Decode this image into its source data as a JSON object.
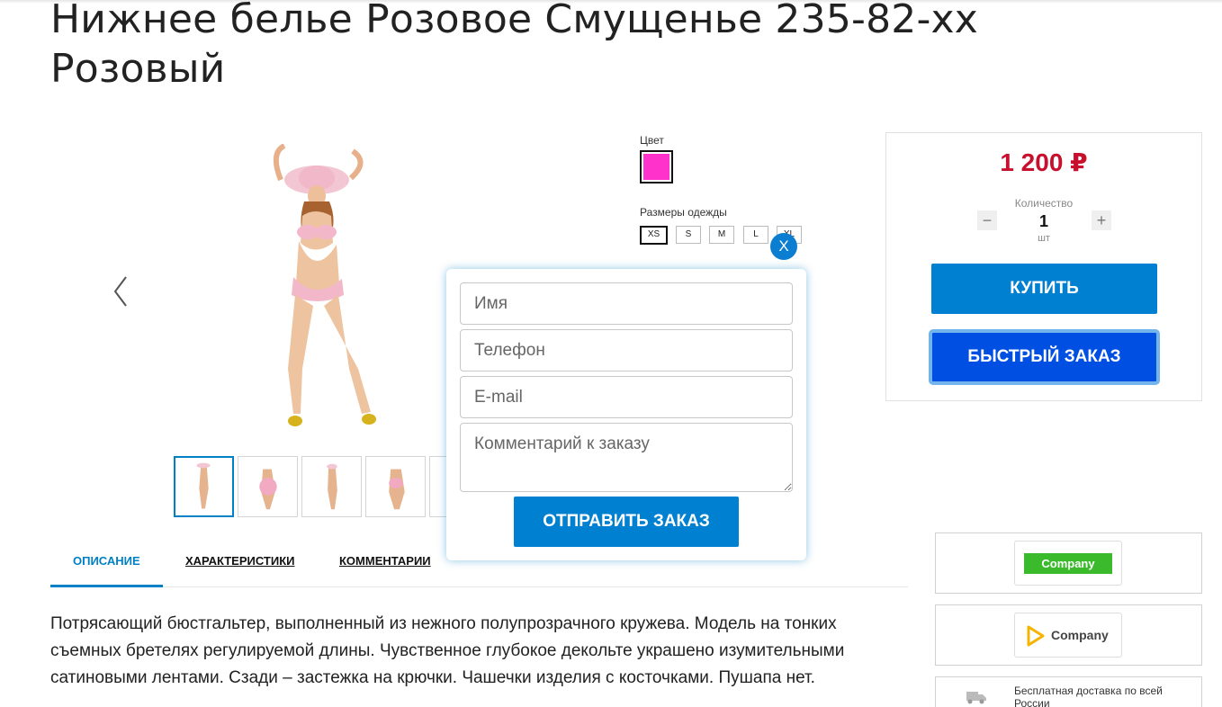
{
  "product": {
    "title": "Нижнее белье Розовое Смущенье 235-82-хх Розовый"
  },
  "gallery": {
    "prev_arrow_icon": "chevron-left-icon",
    "thumbnail_count": 5
  },
  "options": {
    "color_label": "Цвет",
    "color_value": "#ff33cc",
    "size_label": "Размеры одежды",
    "sizes": [
      "XS",
      "S",
      "M",
      "L",
      "XL"
    ],
    "selected_size": "XS"
  },
  "purchase": {
    "price": "1 200 ₽",
    "quantity_label": "Количество",
    "quantity": "1",
    "unit": "шт",
    "minus": "−",
    "plus": "+",
    "buy_label": "КУПИТЬ",
    "quick_order_label": "БЫСТРЫЙ ЗАКАЗ"
  },
  "quick_order_popup": {
    "close_label": "X",
    "name_placeholder": "Имя",
    "phone_placeholder": "Телефон",
    "email_placeholder": "E-mail",
    "comment_placeholder": "Комментарий к заказу",
    "submit_label": "ОТПРАВИТЬ ЗАКАЗ"
  },
  "tabs": [
    {
      "label": "ОПИСАНИЕ",
      "active": true
    },
    {
      "label": "ХАРАКТЕРИСТИКИ",
      "active": false
    },
    {
      "label": "КОММЕНТАРИИ",
      "active": false
    }
  ],
  "description": "Потрясающий бюстгальтер, выполненный из нежного полупрозрачного кружева. Модель на тонких съемных бретелях регулируемой длины. Чувственное глубокое декольте украшено изумительными сатиновыми лентами. Сзади – застежка на крючки. Чашечки изделия с косточками. Пушапа нет.",
  "side": {
    "badge1_text": "Company",
    "badge2_text": "Company",
    "delivery_text": "Бесплатная доставка по всей России",
    "colors": {
      "green": "#3bba2c",
      "yellow": "#f5b400"
    }
  },
  "colors": {
    "accent": "#0080d0",
    "quick_order": "#004fe3",
    "price": "#c8102e"
  }
}
